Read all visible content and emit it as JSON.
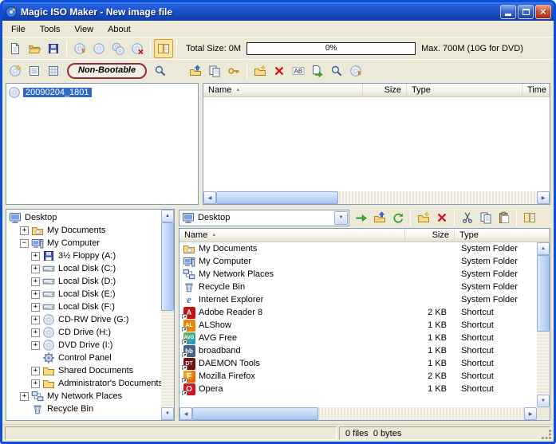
{
  "window": {
    "title": "Magic ISO Maker - New image file"
  },
  "menu": {
    "items": [
      "File",
      "Tools",
      "View",
      "About"
    ]
  },
  "toolbar_main": {
    "buttons": [
      "new-image",
      "open-image",
      "save-image",
      "write-disc",
      "make-image-from-cd",
      "copy-disc",
      "erase-disc",
      "toggle-panels"
    ],
    "total_size_label": "Total Size: 0M",
    "progress_text": "0%",
    "max_label": "Max. 700M (10G for DVD)"
  },
  "toolbar_image": {
    "left_buttons": [
      "new-session",
      "image-properties",
      "sector-edit"
    ],
    "boot_selector": "Non-Bootable",
    "view_boot_button": "view-boot",
    "right_buttons": [
      "up-directory",
      "copy-files",
      "burn-key",
      "new-folder",
      "delete",
      "rename",
      "extract",
      "search",
      "burn-cd"
    ]
  },
  "image_panel": {
    "selected_item": "20090204_1801"
  },
  "iso_list": {
    "columns": [
      "Name",
      "Size",
      "Type",
      "Time"
    ],
    "rows": []
  },
  "tree": {
    "items": [
      {
        "label": "Desktop",
        "depth": 0,
        "expand": "",
        "icon": "desktop"
      },
      {
        "label": "My Documents",
        "depth": 1,
        "expand": "+",
        "icon": "folder-docs"
      },
      {
        "label": "My Computer",
        "depth": 1,
        "expand": "-",
        "icon": "computer"
      },
      {
        "label": "3½ Floppy (A:)",
        "depth": 2,
        "expand": "+",
        "icon": "floppy"
      },
      {
        "label": "Local Disk (C:)",
        "depth": 2,
        "expand": "+",
        "icon": "disk"
      },
      {
        "label": "Local Disk (D:)",
        "depth": 2,
        "expand": "+",
        "icon": "disk"
      },
      {
        "label": "Local Disk (E:)",
        "depth": 2,
        "expand": "+",
        "icon": "disk"
      },
      {
        "label": "Local Disk (F:)",
        "depth": 2,
        "expand": "+",
        "icon": "disk"
      },
      {
        "label": "CD-RW Drive (G:)",
        "depth": 2,
        "expand": "+",
        "icon": "cd"
      },
      {
        "label": "CD Drive (H:)",
        "depth": 2,
        "expand": "+",
        "icon": "cd"
      },
      {
        "label": "DVD Drive (I:)",
        "depth": 2,
        "expand": "+",
        "icon": "cd"
      },
      {
        "label": "Control Panel",
        "depth": 2,
        "expand": "",
        "icon": "control"
      },
      {
        "label": "Shared Documents",
        "depth": 2,
        "expand": "+",
        "icon": "folder"
      },
      {
        "label": "Administrator's Documents",
        "depth": 2,
        "expand": "+",
        "icon": "folder"
      },
      {
        "label": "My Network Places",
        "depth": 1,
        "expand": "+",
        "icon": "network"
      },
      {
        "label": "Recycle Bin",
        "depth": 1,
        "expand": "",
        "icon": "recycle"
      }
    ]
  },
  "explorer": {
    "address": "Desktop",
    "buttons": [
      "go",
      "up-directory",
      "refresh",
      "new-folder",
      "delete",
      "cut",
      "copy",
      "paste",
      "views"
    ],
    "columns": [
      "Name",
      "Size",
      "Type"
    ],
    "rows": [
      {
        "icon": "my-documents",
        "name": "My Documents",
        "size": "",
        "type": "System Folder"
      },
      {
        "icon": "my-computer",
        "name": "My Computer",
        "size": "",
        "type": "System Folder"
      },
      {
        "icon": "my-network-places",
        "name": "My Network Places",
        "size": "",
        "type": "System Folder"
      },
      {
        "icon": "recycle-bin",
        "name": "Recycle Bin",
        "size": "",
        "type": "System Folder"
      },
      {
        "icon": "internet-explorer",
        "name": "Internet Explorer",
        "size": "",
        "type": "System Folder"
      },
      {
        "icon": "adobe-reader",
        "name": "Adobe Reader 8",
        "size": "2 KB",
        "type": "Shortcut"
      },
      {
        "icon": "alshow",
        "name": "ALShow",
        "size": "1 KB",
        "type": "Shortcut"
      },
      {
        "icon": "avg",
        "name": "AVG Free",
        "size": "1 KB",
        "type": "Shortcut"
      },
      {
        "icon": "broadband",
        "name": "broadband",
        "size": "1 KB",
        "type": "Shortcut"
      },
      {
        "icon": "daemon-tools",
        "name": "DAEMON Tools",
        "size": "1 KB",
        "type": "Shortcut"
      },
      {
        "icon": "firefox",
        "name": "Mozilla Firefox",
        "size": "2 KB",
        "type": "Shortcut"
      },
      {
        "icon": "opera",
        "name": "Opera",
        "size": "1 KB",
        "type": "Shortcut"
      }
    ]
  },
  "statusbar": {
    "info": "0 files  0 bytes"
  }
}
